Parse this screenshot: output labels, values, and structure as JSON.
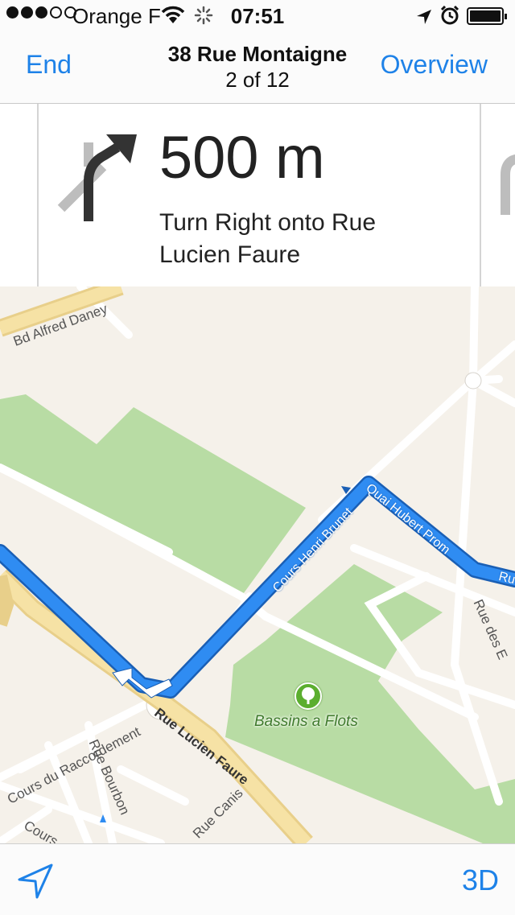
{
  "status_bar": {
    "carrier": "Orange F",
    "time": "07:51",
    "signal_strength": 3,
    "signal_max": 5,
    "battery_level": 1.0
  },
  "nav": {
    "end_label": "End",
    "title": "38 Rue Montaigne",
    "step": "2 of 12",
    "overview_label": "Overview"
  },
  "instruction": {
    "distance": "500 m",
    "text": "Turn Right onto Rue Lucien Faure",
    "maneuver_icon": "turn-right-arrow-icon"
  },
  "map": {
    "street_labels": {
      "bd_alfred_daney": "Bd Alfred Daney",
      "rue_lucien_faure": "Rue Lucien Faure",
      "cours_du_raccordement": "Cours du Raccordement",
      "rue_bourbon": "Rue Bourbon",
      "rue_des_e": "Rue des E",
      "cours_2": "Cours",
      "rue_canis": "Rue Canis"
    },
    "route_labels": {
      "cours_henri_brunet": "Cours Henri Brunet",
      "quai_hubert_prom": "Quai Hubert Prom",
      "ru": "Ru"
    },
    "poi": {
      "name": "Bassins a Flots",
      "icon": "tree-icon"
    },
    "colors": {
      "route": "#2f8cf2",
      "park": "#b8dca4",
      "land": "#f5f1ea",
      "major_road": "#f6e2a5"
    }
  },
  "toolbar": {
    "locate_icon": "location-arrow-icon",
    "three_d_label": "3D"
  },
  "accent_color": "#1e82e8"
}
